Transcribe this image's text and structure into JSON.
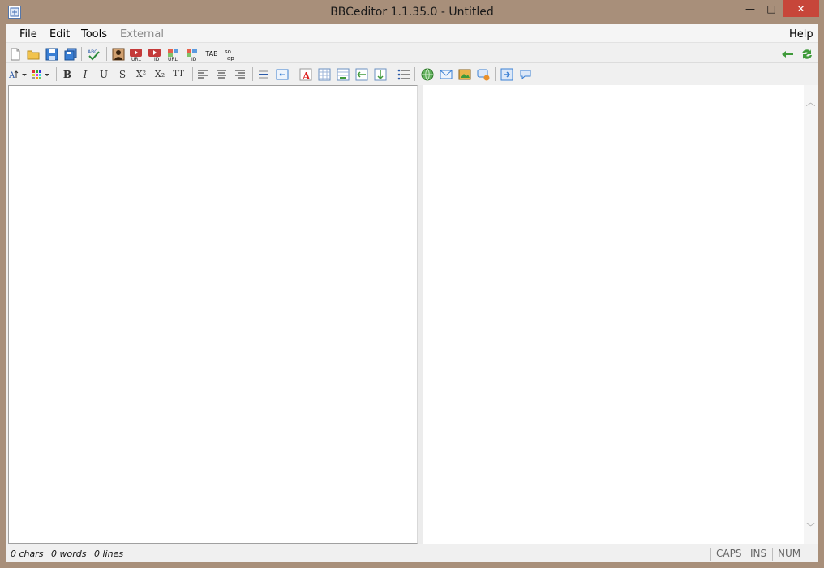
{
  "window": {
    "title": "BBCeditor 1.1.35.0 - Untitled",
    "controls": {
      "minimize": "—",
      "maximize": "□",
      "close": "✕"
    }
  },
  "menubar": {
    "items": [
      {
        "label": "File",
        "enabled": true
      },
      {
        "label": "Edit",
        "enabled": true
      },
      {
        "label": "Tools",
        "enabled": true
      },
      {
        "label": "External",
        "enabled": false
      }
    ],
    "help": "Help"
  },
  "toolbar1": {
    "buttons": [
      "new-file-icon",
      "open-folder-icon",
      "save-icon",
      "save-all-icon",
      "spellcheck-icon",
      "image-icon",
      "youtube-url-icon",
      "youtube-id-icon",
      "video-url-icon",
      "video-id-icon",
      "tab-icon",
      "soap-icon",
      "back-arrow-icon",
      "refresh-icon"
    ],
    "tab_label": "TAB",
    "soap_label": "so ap"
  },
  "toolbar2": {
    "bold": "B",
    "italic": "I",
    "underline": "U",
    "strike": "S",
    "superscript": "X²",
    "subscript": "X₂",
    "typewriter": "TT",
    "font_size": "A"
  },
  "status": {
    "chars": "0 chars",
    "words": "0 words",
    "lines": "0 lines",
    "caps": "CAPS",
    "ins": "INS",
    "num": "NUM"
  },
  "colors": {
    "frame": "#a88f7a",
    "close": "#c7463a",
    "panel": "#f0f0f0"
  }
}
